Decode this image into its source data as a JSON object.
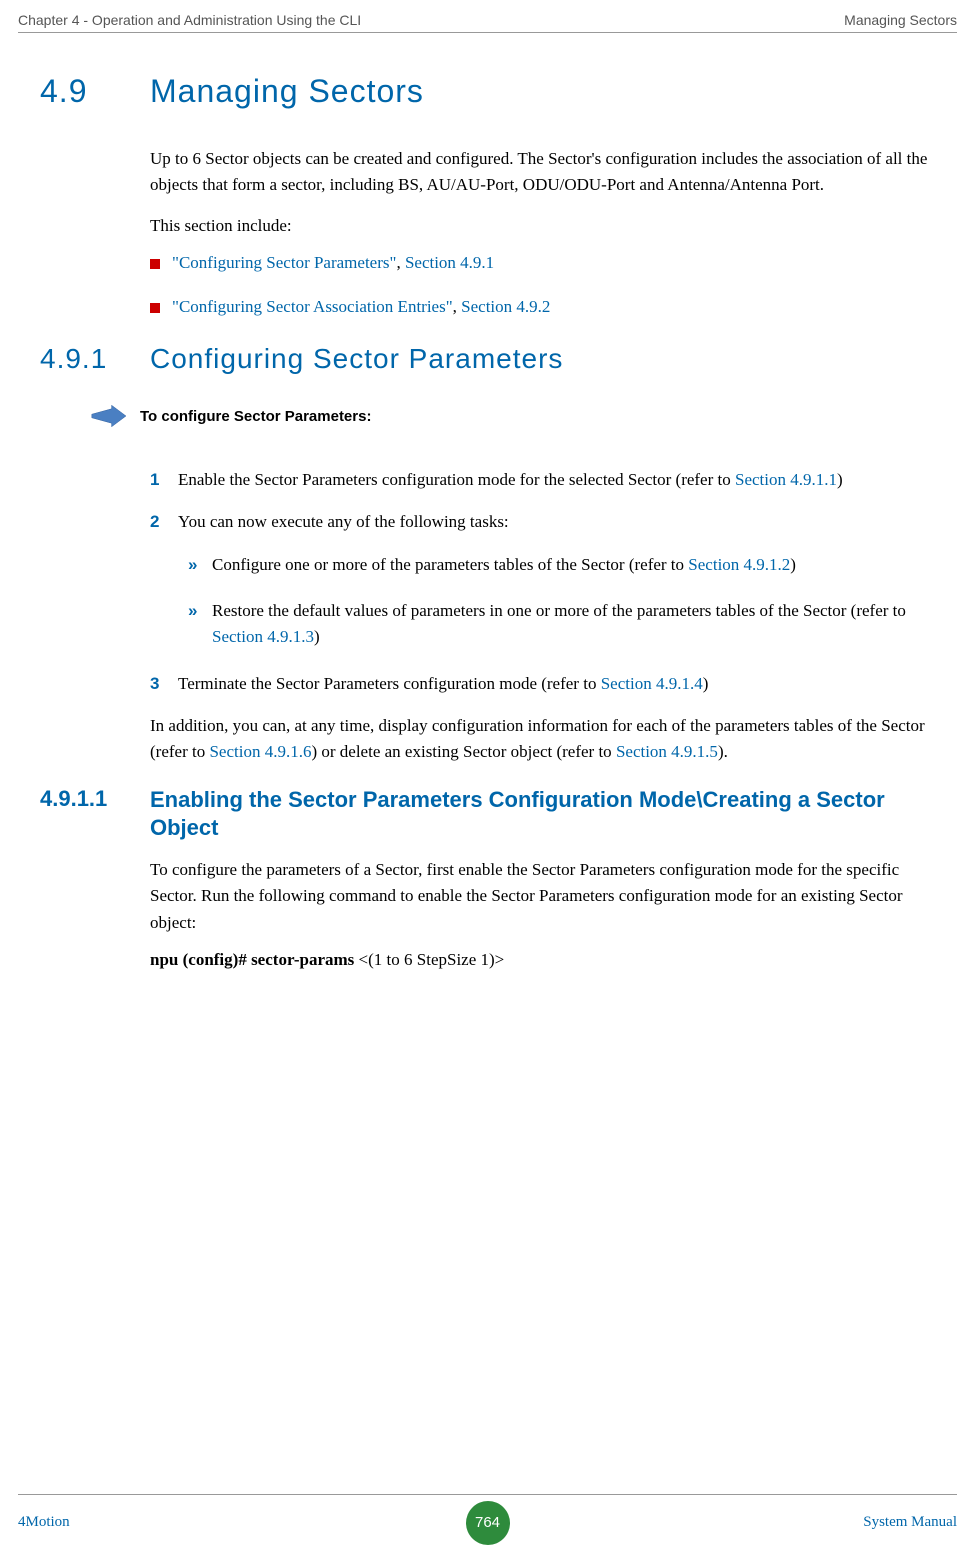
{
  "header": {
    "left": "Chapter 4 - Operation and Administration Using the CLI",
    "right": "Managing Sectors"
  },
  "section49": {
    "number": "4.9",
    "title": "Managing Sectors"
  },
  "intro": {
    "p1": "Up to 6 Sector objects can be created and configured. The Sector's configuration includes the association of all the objects that form a sector, including BS, AU/AU-Port, ODU/ODU-Port and Antenna/Antenna Port.",
    "p2": "This section include:"
  },
  "bullets": {
    "b1_link": "\"Configuring Sector Parameters\"",
    "b1_sep": ", ",
    "b1_ref": "Section 4.9.1",
    "b2_link": "\"Configuring Sector Association Entries\"",
    "b2_sep": ", ",
    "b2_ref": "Section 4.9.2"
  },
  "section491": {
    "number": "4.9.1",
    "title": "Configuring Sector Parameters"
  },
  "procedure": {
    "label": "To configure Sector Parameters:"
  },
  "steps": {
    "n1": "1",
    "t1a": "Enable the Sector Parameters configuration mode for the selected Sector (refer to ",
    "t1b": "Section 4.9.1.1",
    "t1c": ")",
    "n2": "2",
    "t2": "You can now execute any of the following tasks:",
    "sb1a": "Configure one or more of the parameters tables of the Sector (refer to ",
    "sb1b": "Section 4.9.1.2",
    "sb1c": ")",
    "sb2a": "Restore the default values of parameters in one or more of the parameters tables of the Sector (refer to ",
    "sb2b": "Section 4.9.1.3",
    "sb2c": ")",
    "n3": "3",
    "t3a": "Terminate the Sector Parameters configuration mode (refer to ",
    "t3b": "Section 4.9.1.4",
    "t3c": ")"
  },
  "after_steps": {
    "p1a": "In addition, you can, at any time, display configuration information for each of the parameters tables of the Sector (refer to ",
    "p1b": "Section 4.9.1.6",
    "p1c": ") or delete an existing Sector object (refer to ",
    "p1d": "Section 4.9.1.5",
    "p1e": ")."
  },
  "section4911": {
    "number": "4.9.1.1",
    "title": "Enabling the Sector Parameters Configuration Mode\\Creating a Sector Object"
  },
  "sec4911_body": {
    "p1": "To configure the parameters of a Sector, first enable the Sector Parameters configuration mode for the specific Sector. Run the following command to enable the Sector Parameters configuration mode for an existing Sector object:",
    "cmd_bold": "npu (config)# sector-params ",
    "cmd_rest": "<(1 to 6 StepSize 1)>"
  },
  "footer": {
    "left": "4Motion",
    "center": "764",
    "right": "System Manual"
  },
  "chevron": "»"
}
